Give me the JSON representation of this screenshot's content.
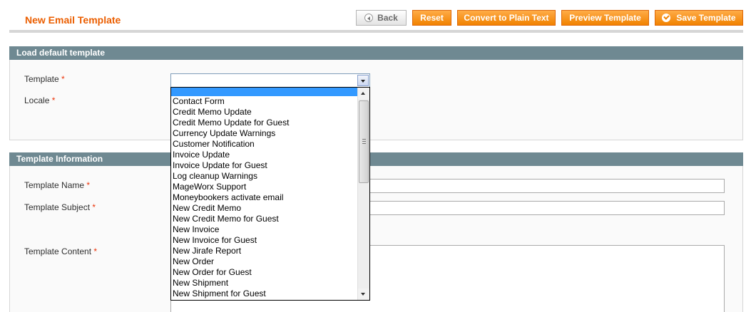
{
  "header": {
    "title": "New Email Template",
    "buttons": {
      "back": "Back",
      "reset": "Reset",
      "convert": "Convert to Plain Text",
      "preview": "Preview Template",
      "save": "Save Template"
    }
  },
  "load_section": {
    "title": "Load default template",
    "template_label": "Template",
    "locale_label": "Locale",
    "required_mark": "*"
  },
  "info_section": {
    "title": "Template Information",
    "name_label": "Template Name",
    "subject_label": "Template Subject",
    "content_label": "Template Content",
    "required_mark": "*"
  },
  "template_select": {
    "selected_value": "",
    "options": [
      "",
      "Contact Form",
      "Credit Memo Update",
      "Credit Memo Update for Guest",
      "Currency Update Warnings",
      "Customer Notification",
      "Invoice Update",
      "Invoice Update for Guest",
      "Log cleanup Warnings",
      "MageWorx Support",
      "Moneybookers activate email",
      "New Credit Memo",
      "New Credit Memo for Guest",
      "New Invoice",
      "New Invoice for Guest",
      "New Jirafe Report",
      "New Order",
      "New Order for Guest",
      "New Shipment",
      "New Shipment for Guest"
    ]
  },
  "colors": {
    "accent": "#eb5e00",
    "button": "#f18200",
    "section_header": "#6f8992",
    "selection": "#3399ff",
    "required": "#eb340a"
  }
}
